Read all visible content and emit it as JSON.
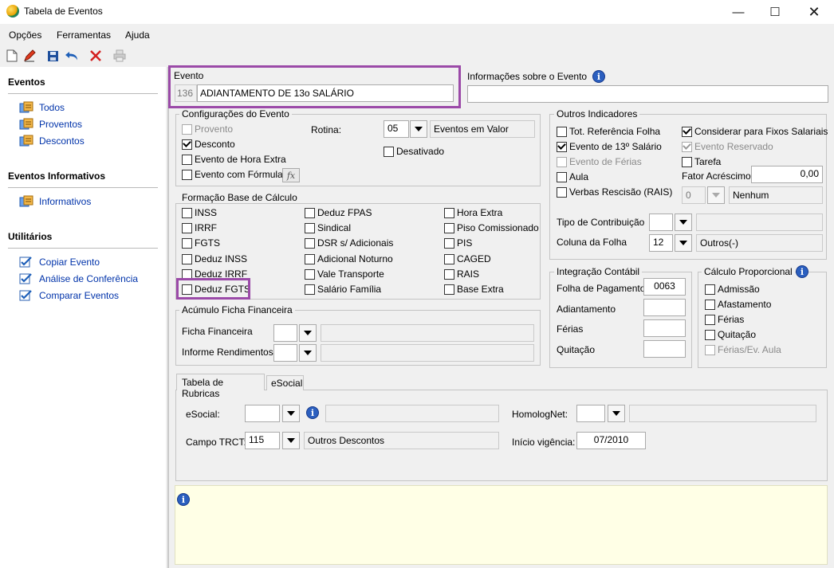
{
  "window": {
    "title": "Tabela de Eventos"
  },
  "menu": [
    "Opções",
    "Ferramentas",
    "Ajuda"
  ],
  "sidebar": {
    "sections": [
      {
        "title": "Eventos",
        "items": [
          "Todos",
          "Proventos",
          "Descontos"
        ]
      },
      {
        "title": "Eventos Informativos",
        "items": [
          "Informativos"
        ]
      },
      {
        "title": "Utilitários",
        "items": [
          "Copiar Evento",
          "Análise de Conferência",
          "Comparar Eventos"
        ]
      }
    ]
  },
  "evento": {
    "label": "Evento",
    "code": "136",
    "name": "ADIANTAMENTO DE 13o SALÁRIO"
  },
  "info_evento": {
    "label": "Informações sobre o Evento",
    "value": ""
  },
  "config": {
    "title": "Configurações do Evento",
    "provento": "Provento",
    "desconto": "Desconto",
    "hora_extra": "Evento de Hora Extra",
    "formula": "Evento com Fórmula",
    "formula_btn": "fx",
    "rotina_label": "Rotina:",
    "rotina_value": "05",
    "rotina_desc": "Eventos em Valor",
    "desativado": "Desativado"
  },
  "base_calculo": {
    "title": "Formação Base de Cálculo",
    "col1": [
      "INSS",
      "IRRF",
      "FGTS",
      "Deduz INSS",
      "Deduz IRRF",
      "Deduz FGTS"
    ],
    "col2": [
      "Deduz FPAS",
      "Sindical",
      "DSR s/ Adicionais",
      "Adicional Noturno",
      "Vale Transporte",
      "Salário Família"
    ],
    "col3": [
      "Hora Extra",
      "Piso Comissionado",
      "PIS",
      "CAGED",
      "RAIS",
      "Base Extra"
    ]
  },
  "acumulo": {
    "title": "Acúmulo Ficha Financeira",
    "ficha": "Ficha Financeira",
    "informe": "Informe Rendimentos"
  },
  "outros": {
    "title": "Outros Indicadores",
    "tot_ref": "Tot. Referência Folha",
    "evento13": "Evento de 13º Salário",
    "ferias": "Evento de Férias",
    "aula": "Aula",
    "verbas": "Verbas Rescisão (RAIS)",
    "verbas_value": "0",
    "verbas_desc": "Nenhum",
    "fixos": "Considerar para Fixos Salariais",
    "reservado": "Evento Reservado",
    "tarefa": "Tarefa",
    "fator_label": "Fator Acréscimo",
    "fator_value": "0,00",
    "tipo_contrib": "Tipo de Contribuição",
    "coluna_label": "Coluna da Folha",
    "coluna_value": "12",
    "coluna_desc": "Outros(-)"
  },
  "integracao": {
    "title": "Integração Contábil",
    "folha": "Folha de Pagamento",
    "folha_value": "0063",
    "adiantamento": "Adiantamento",
    "ferias": "Férias",
    "quitacao": "Quitação"
  },
  "proporcional": {
    "title": "Cálculo Proporcional",
    "items": [
      "Admissão",
      "Afastamento",
      "Férias",
      "Quitação",
      "Férias/Ev. Aula"
    ]
  },
  "tabs": [
    "Tabela de Rubricas",
    "eSocial"
  ],
  "rubricas": {
    "esocial_label": "eSocial:",
    "homolog_label": "HomologNet:",
    "trct_label": "Campo TRCT:",
    "trct_value": "115",
    "trct_desc": "Outros Descontos",
    "inicio_label": "Início vigência:",
    "inicio_value": "07/2010"
  },
  "colors": {
    "highlight": "#9b4aa8",
    "link": "#0033aa",
    "note_bg": "#ffffe6"
  }
}
